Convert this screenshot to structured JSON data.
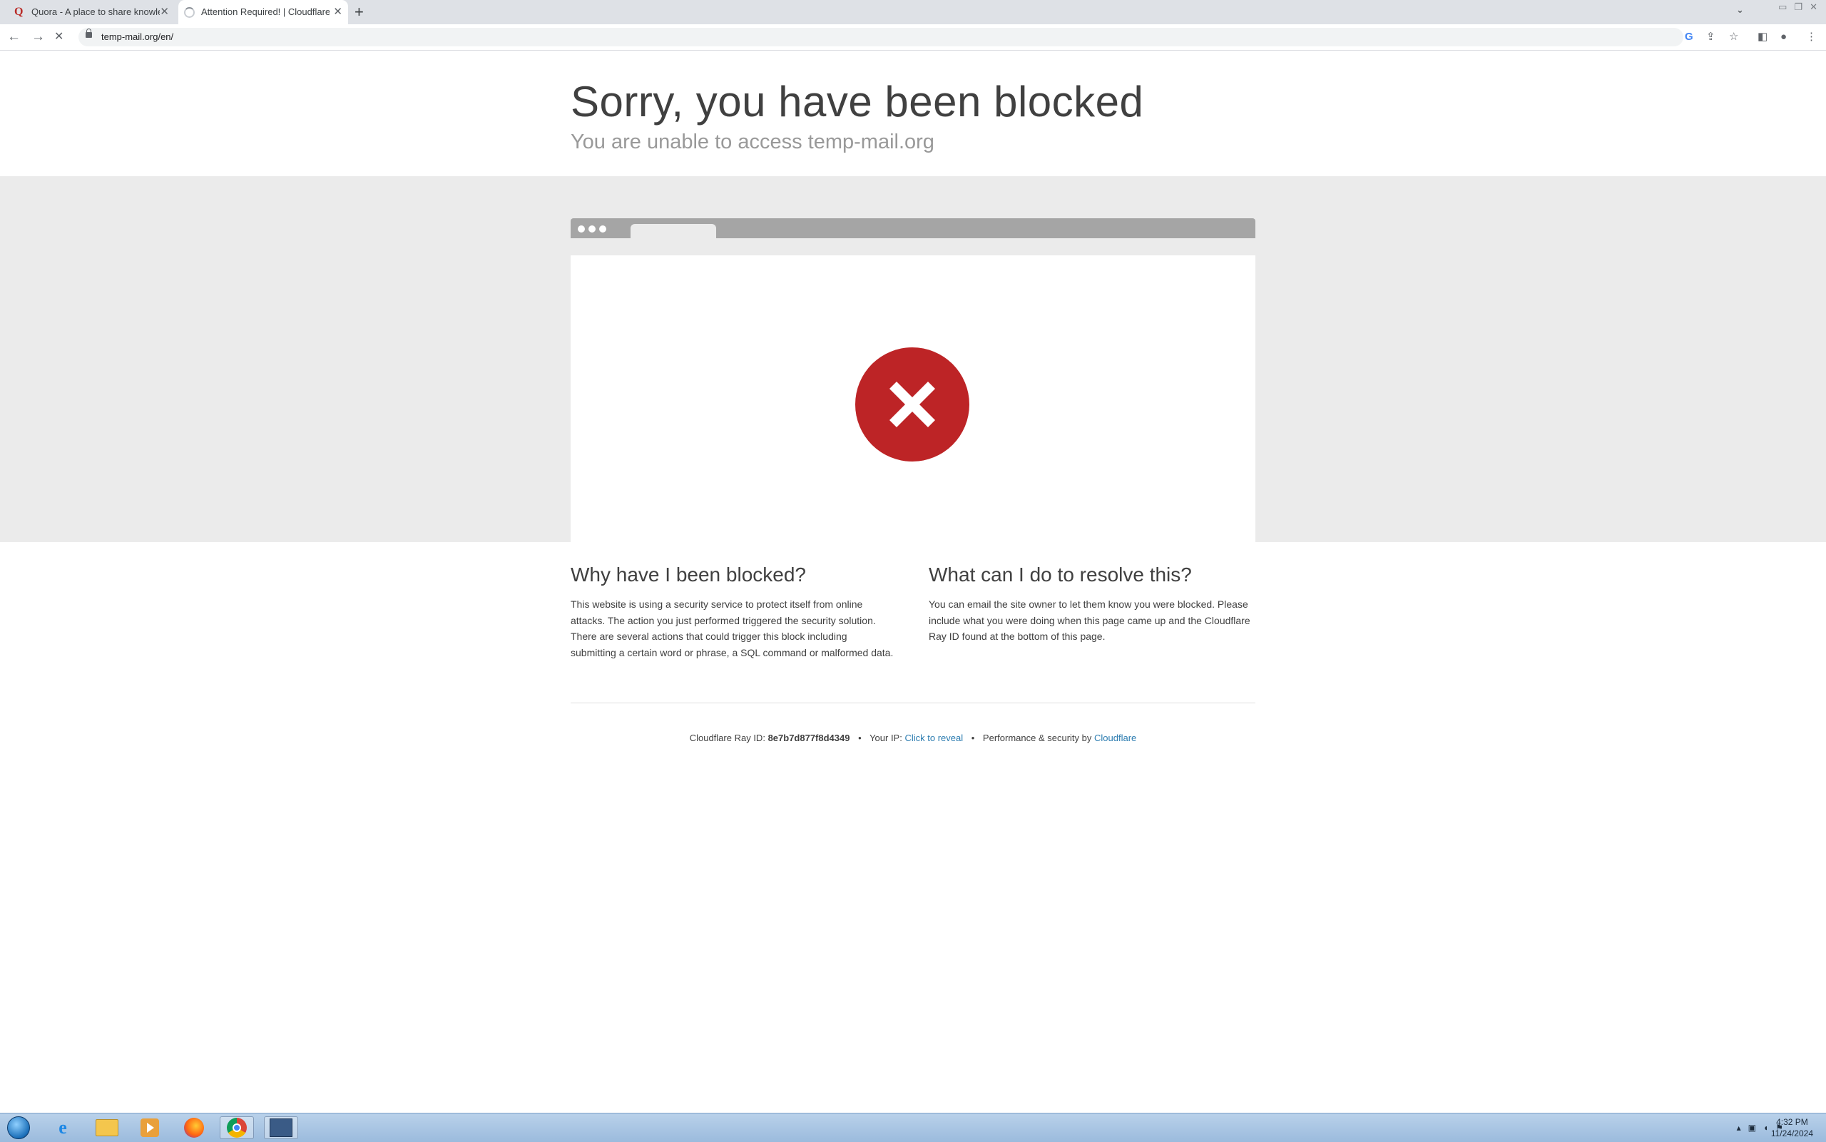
{
  "browser": {
    "tabs": [
      {
        "title": "Quora - A place to share knowle...",
        "active": false,
        "icon": "quora-icon"
      },
      {
        "title": "Attention Required! | Cloudflare",
        "active": true,
        "icon": "loading-spinner-icon"
      }
    ],
    "new_tab_label": "+",
    "url": "temp-mail.org/en/"
  },
  "page": {
    "title": "Sorry, you have been blocked",
    "subtitle": "You are unable to access temp-mail.org",
    "why_heading": "Why have I been blocked?",
    "why_text": "This website is using a security service to protect itself from online attacks. The action you just performed triggered the security solution. There are several actions that could trigger this block including submitting a certain word or phrase, a SQL command or malformed data.",
    "resolve_heading": "What can I do to resolve this?",
    "resolve_text": "You can email the site owner to let them know you were blocked. Please include what you were doing when this page came up and the Cloudflare Ray ID found at the bottom of this page.",
    "footer": {
      "ray_label": "Cloudflare Ray ID:",
      "ray_id": "8e7b7d877f8d4349",
      "ip_label": "Your IP:",
      "ip_link": "Click to reveal",
      "perf_label": "Performance & security by",
      "cf_link": "Cloudflare",
      "bullet": "•"
    }
  },
  "taskbar": {
    "time": "4:32 PM",
    "date": "11/24/2024"
  },
  "colors": {
    "error_red": "#bd2426",
    "link_blue": "#2c7cb0",
    "band_gray": "#ebebeb"
  }
}
